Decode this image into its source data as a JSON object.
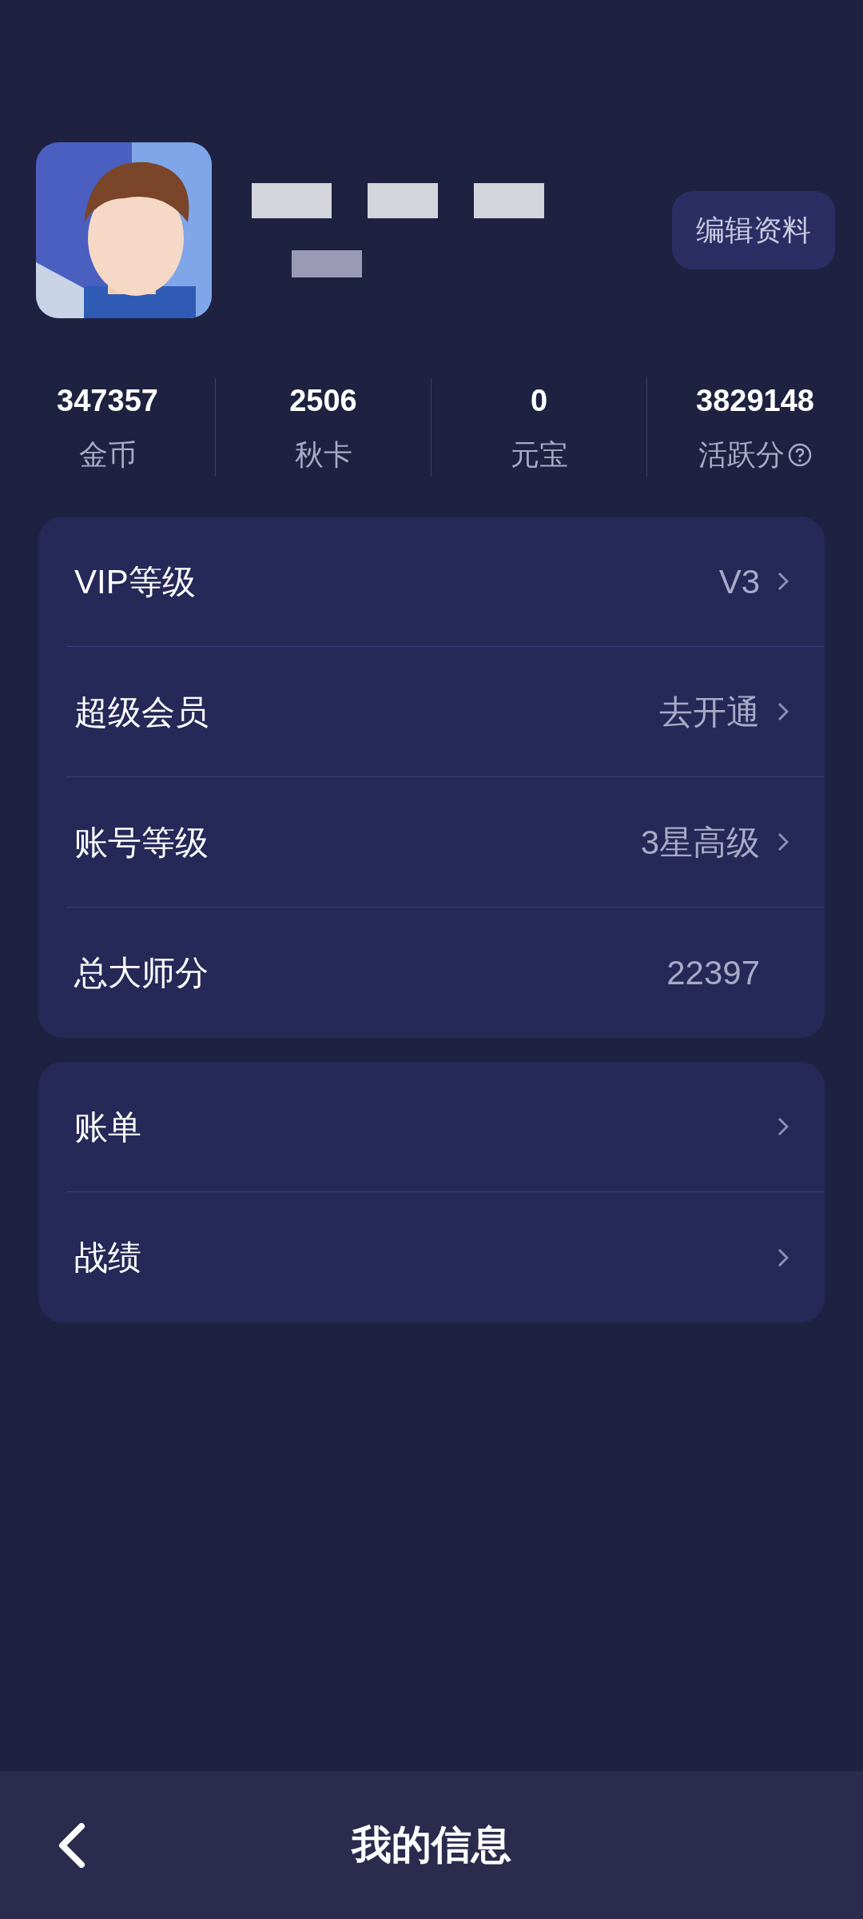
{
  "profile": {
    "edit_button": "编辑资料"
  },
  "stats": [
    {
      "value": "347357",
      "label": "金币",
      "help": false
    },
    {
      "value": "2506",
      "label": "秋卡",
      "help": false
    },
    {
      "value": "0",
      "label": "元宝",
      "help": false
    },
    {
      "value": "3829148",
      "label": "活跃分",
      "help": true
    }
  ],
  "groups": [
    [
      {
        "label": "VIP等级",
        "value": "V3",
        "arrow": true
      },
      {
        "label": "超级会员",
        "value": "去开通",
        "arrow": true
      },
      {
        "label": "账号等级",
        "value": "3星高级",
        "arrow": true
      },
      {
        "label": "总大师分",
        "value": "22397",
        "arrow": false
      }
    ],
    [
      {
        "label": "账单",
        "arrow": true
      },
      {
        "label": "战绩",
        "arrow": true
      }
    ]
  ],
  "bottom_bar": {
    "title": "我的信息"
  }
}
